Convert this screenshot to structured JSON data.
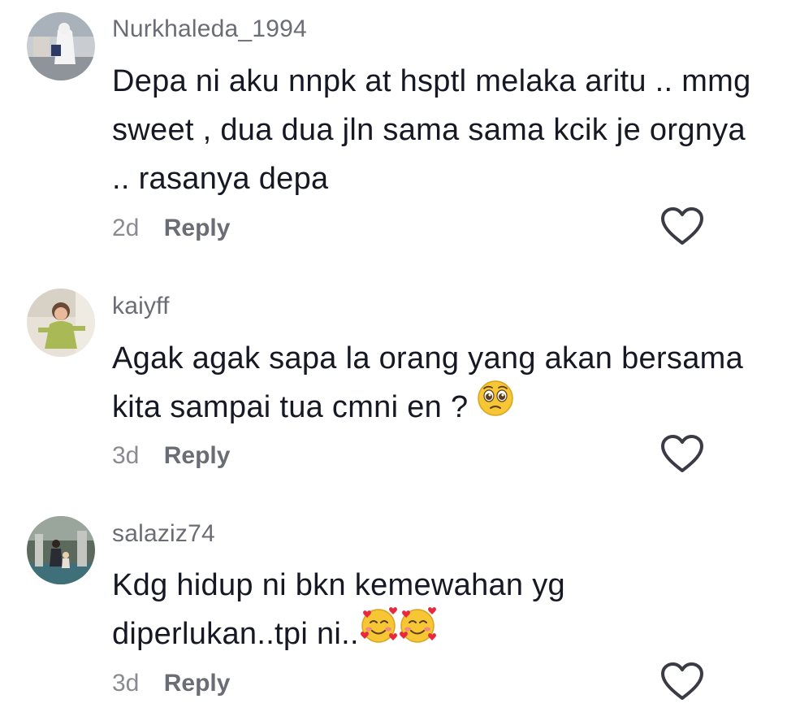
{
  "comments": [
    {
      "username": "Nurkhaleda_1994",
      "text": "Depa ni aku nnpk at hsptl melaka aritu .. mmg sweet , dua dua jln sama sama kcik je orgnya .. rasanya depa",
      "time": "2d",
      "reply_label": "Reply",
      "emoji": []
    },
    {
      "username": "kaiyff",
      "text": "Agak agak sapa la orang yang akan bersama kita sampai tua cmni en ?",
      "time": "3d",
      "reply_label": "Reply",
      "emoji": [
        "pleading-face"
      ]
    },
    {
      "username": "salaziz74",
      "text": "Kdg hidup ni bkn kemewahan yg diperlukan..tpi ni..",
      "time": "3d",
      "reply_label": "Reply",
      "emoji": [
        "smiling-face-with-hearts",
        "smiling-face-with-hearts"
      ]
    }
  ],
  "icons": {
    "like": "heart-outline-icon"
  },
  "colors": {
    "text": "#161823",
    "username": "#6b6d75",
    "time": "#8a8b91",
    "heart_stroke": "#3a3b45"
  }
}
